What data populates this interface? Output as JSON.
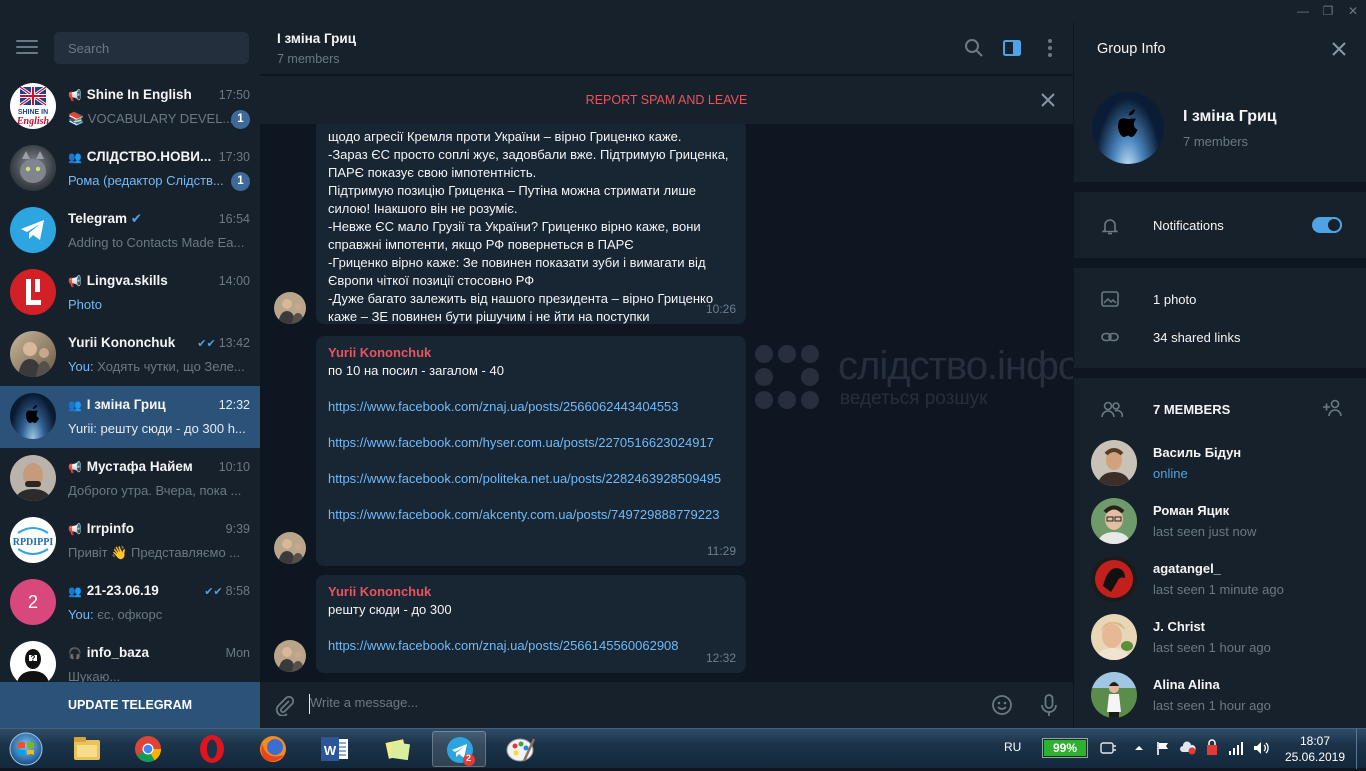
{
  "window": {
    "minimize": "—",
    "maximize": "❐",
    "close": "✕"
  },
  "sidebar": {
    "search_placeholder": "Search",
    "chats": [
      {
        "name": "Shine In English",
        "time": "17:50",
        "preview": "📚 VOCABULARY DEVEL...",
        "badge": "1",
        "type": "channel"
      },
      {
        "name": "СЛІДСТВО.НОВИ...",
        "time": "17:30",
        "preview": "Рома (редактор Слідств...",
        "badge": "1",
        "type": "group"
      },
      {
        "name": "Telegram",
        "time": "16:54",
        "preview": "Adding to Contacts Made Ea...",
        "verified": "✔",
        "type": "user"
      },
      {
        "name": "Lingva.skills",
        "time": "14:00",
        "preview": "Photo",
        "type": "channel"
      },
      {
        "name": "Yurii Kononchuk",
        "time": "13:42",
        "you": "You:",
        "preview": "Ходять чутки, що Зеле...",
        "type": "user"
      },
      {
        "name": "І зміна Гриц",
        "time": "12:32",
        "preview": "Yurii: решту сюди - до 300  h...",
        "type": "group"
      },
      {
        "name": "Мустафа Найем",
        "time": "10:10",
        "preview": "Доброго утра. Вчера, пока ...",
        "type": "channel"
      },
      {
        "name": "Irrpinfo",
        "time": "9:39",
        "preview": "Привіт 👋 Представляємо ...",
        "type": "channel"
      },
      {
        "name": "21-23.06.19",
        "time": "8:58",
        "you": "You:",
        "preview": "єс, офкорс",
        "avatar_letter": "2",
        "type": "group"
      },
      {
        "name": "info_baza",
        "time": "Mon",
        "preview": "Шукаю...",
        "type": "bot"
      }
    ],
    "update_label": "UPDATE TELEGRAM"
  },
  "chat": {
    "title": "І зміна Гриц",
    "subtitle": "7 members",
    "spam_label": "REPORT SPAM AND LEAVE",
    "messages": [
      {
        "lines": [
          "щодо агресії Кремля проти України – вірно Гриценко каже.",
          "-Зараз ЄС просто соплі жує, задовбали вже. Підтримую Гриценка, ПАРЄ показує свою імпотентність.",
          "Підтримую позицію Гриценка – Путіна можна стримати лише силою! Інакшого він не розуміє.",
          "-Невже ЄС мало Грузії та України? Гриценко вірно каже, вони справжні імпотенти, якщо РФ повернеться в ПАРЄ",
          "-Гриценко вірно каже: Зе повинен показати зуби і вимагати від Європи чіткої позиції стосовно РФ",
          "-Дуже багато залежить від нашого президента – вірно Гриценко каже – ЗЕ повинен бути рішучим і не йти на поступки"
        ],
        "time": "10:26"
      },
      {
        "author": "Yurii Kononchuk",
        "text": "по 10 на посил - загалом - 40",
        "links": [
          "https://www.facebook.com/znaj.ua/posts/2566062443404553",
          "https://www.facebook.com/hyser.com.ua/posts/2270516623024917",
          "https://www.facebook.com/politeka.net.ua/posts/2282463928509495",
          "https://www.facebook.com/akcenty.com.ua/posts/749729888779223"
        ],
        "time": "11:29"
      },
      {
        "author": "Yurii Kononchuk",
        "text": "решту сюди - до 300",
        "links": [
          "https://www.facebook.com/znaj.ua/posts/2566145560062908"
        ],
        "time": "12:32"
      }
    ],
    "watermark_main": "слідство.інфо",
    "watermark_sub": "ведеться розшук",
    "composer_placeholder": "Write a message..."
  },
  "info": {
    "title": "Group Info",
    "group_name": "І зміна Гриц",
    "group_members": "7 members",
    "notifications_label": "Notifications",
    "notifications_on": true,
    "photos": "1 photo",
    "links": "34 shared links",
    "members_header": "7 MEMBERS",
    "members": [
      {
        "name": "Василь Бідун",
        "status": "online"
      },
      {
        "name": "Роман Яцик",
        "status": "last seen just now"
      },
      {
        "name": "agatangel_",
        "status": "last seen 1 minute ago"
      },
      {
        "name": "J. Christ",
        "status": "last seen 1 hour ago"
      },
      {
        "name": "Alina Alina",
        "status": "last seen 1 hour ago"
      }
    ]
  },
  "taskbar": {
    "lang": "RU",
    "battery": "99%",
    "time": "18:07",
    "date": "25.06.2019",
    "telegram_badge": "2"
  },
  "colors": {
    "accent": "#2b5278",
    "link": "#71baf7",
    "spam": "#e8545f",
    "bg": "#0e1621",
    "panel": "#17212b"
  }
}
